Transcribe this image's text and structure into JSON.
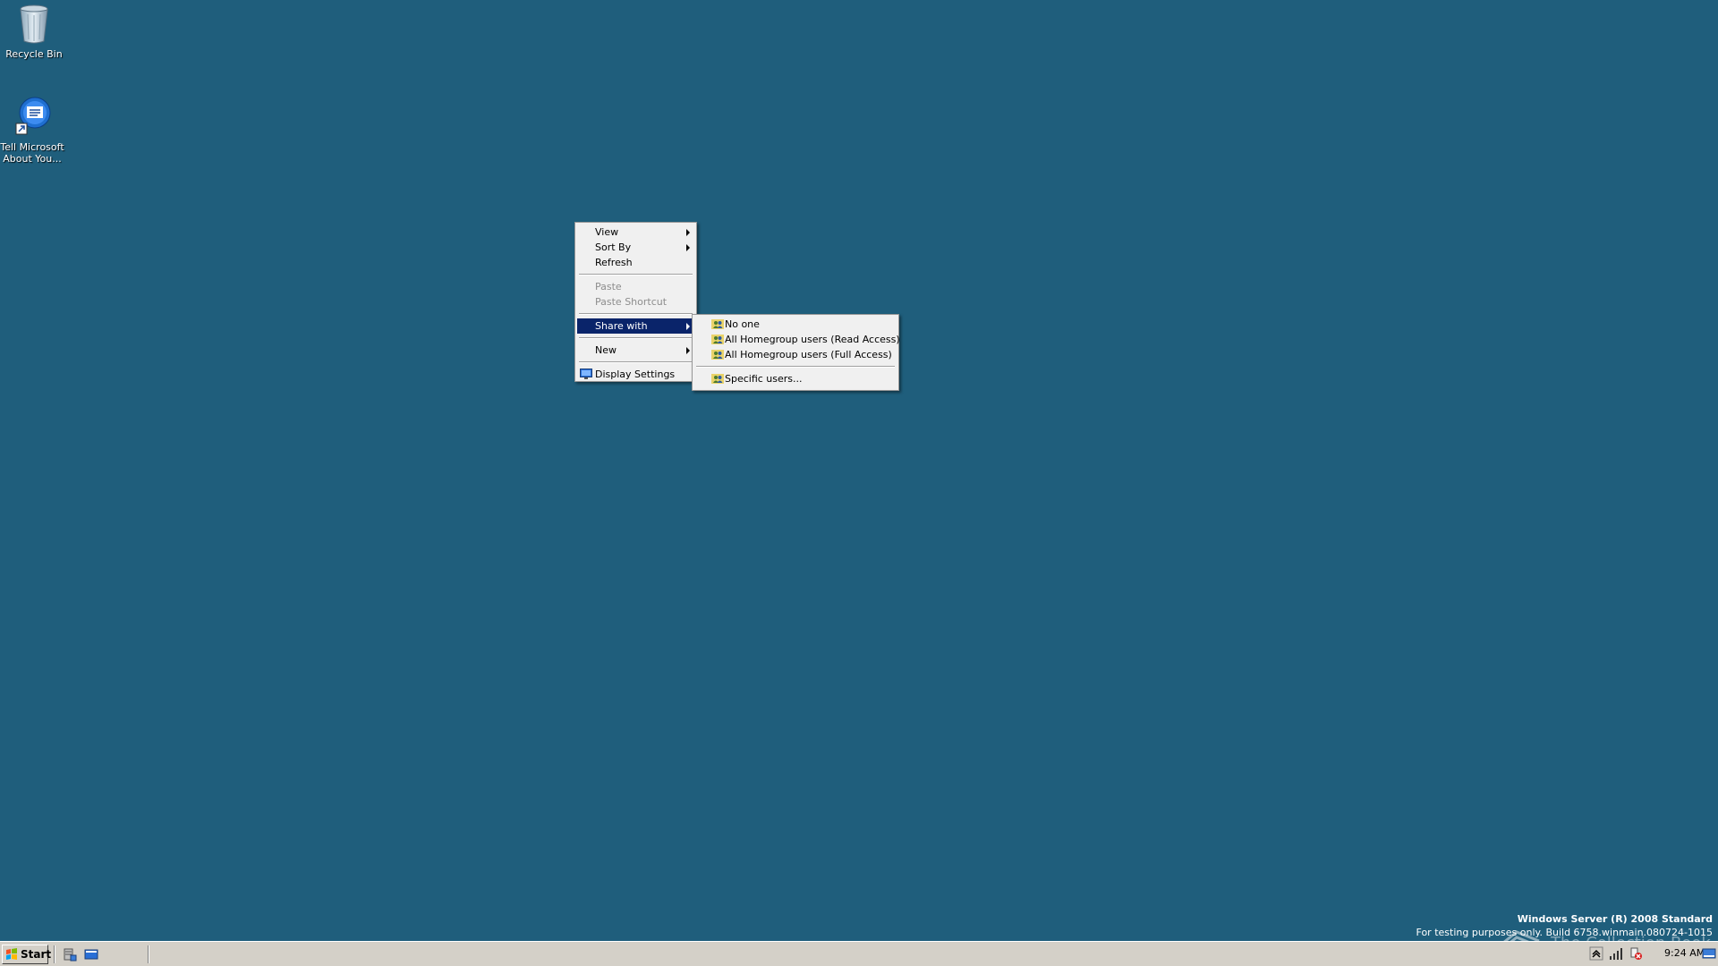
{
  "desktop": {
    "background_color": "#1f5e7c",
    "icons": [
      {
        "label": "Recycle Bin",
        "icon": "recycle-bin-icon"
      },
      {
        "label_line1": "Tell Microsoft",
        "label_line2": "About You...",
        "icon": "feedback-icon"
      }
    ]
  },
  "context_menu": {
    "items": [
      {
        "label": "View",
        "has_submenu": true,
        "enabled": true
      },
      {
        "label": "Sort By",
        "has_submenu": true,
        "enabled": true
      },
      {
        "label": "Refresh",
        "has_submenu": false,
        "enabled": true
      },
      {
        "label": "Paste",
        "has_submenu": false,
        "enabled": false
      },
      {
        "label": "Paste Shortcut",
        "has_submenu": false,
        "enabled": false
      },
      {
        "label": "Share with",
        "has_submenu": true,
        "enabled": true,
        "highlighted": true
      },
      {
        "label": "New",
        "has_submenu": true,
        "enabled": true
      },
      {
        "label": "Display Settings",
        "has_submenu": false,
        "enabled": true,
        "icon": "display-settings-icon"
      }
    ]
  },
  "share_submenu": {
    "items": [
      {
        "label": "No one",
        "icon": "users-icon"
      },
      {
        "label": "All Homegroup users (Read Access)",
        "icon": "users-icon"
      },
      {
        "label": "All Homegroup users (Full Access)",
        "icon": "users-icon"
      },
      {
        "label": "Specific users...",
        "icon": "users-icon"
      }
    ]
  },
  "watermark": {
    "line1": "Windows Server (R) 2008 Standard",
    "line2": "For testing purposes only. Build 6758.winmain.080724-1015",
    "overlay_text": "The Collection Book"
  },
  "taskbar": {
    "start_label": "Start",
    "clock": "9:24 AM",
    "quick_launch": [
      "server-manager-icon",
      "show-desktop-icon"
    ],
    "tray_icons": [
      "show-hidden-icons-icon",
      "network-icon",
      "action-center-icon",
      "show-desktop-tray-icon"
    ]
  },
  "colors": {
    "menu_highlight": "#0a246a",
    "menu_background": "#f0f0f0",
    "taskbar": "#d4d0c8"
  }
}
